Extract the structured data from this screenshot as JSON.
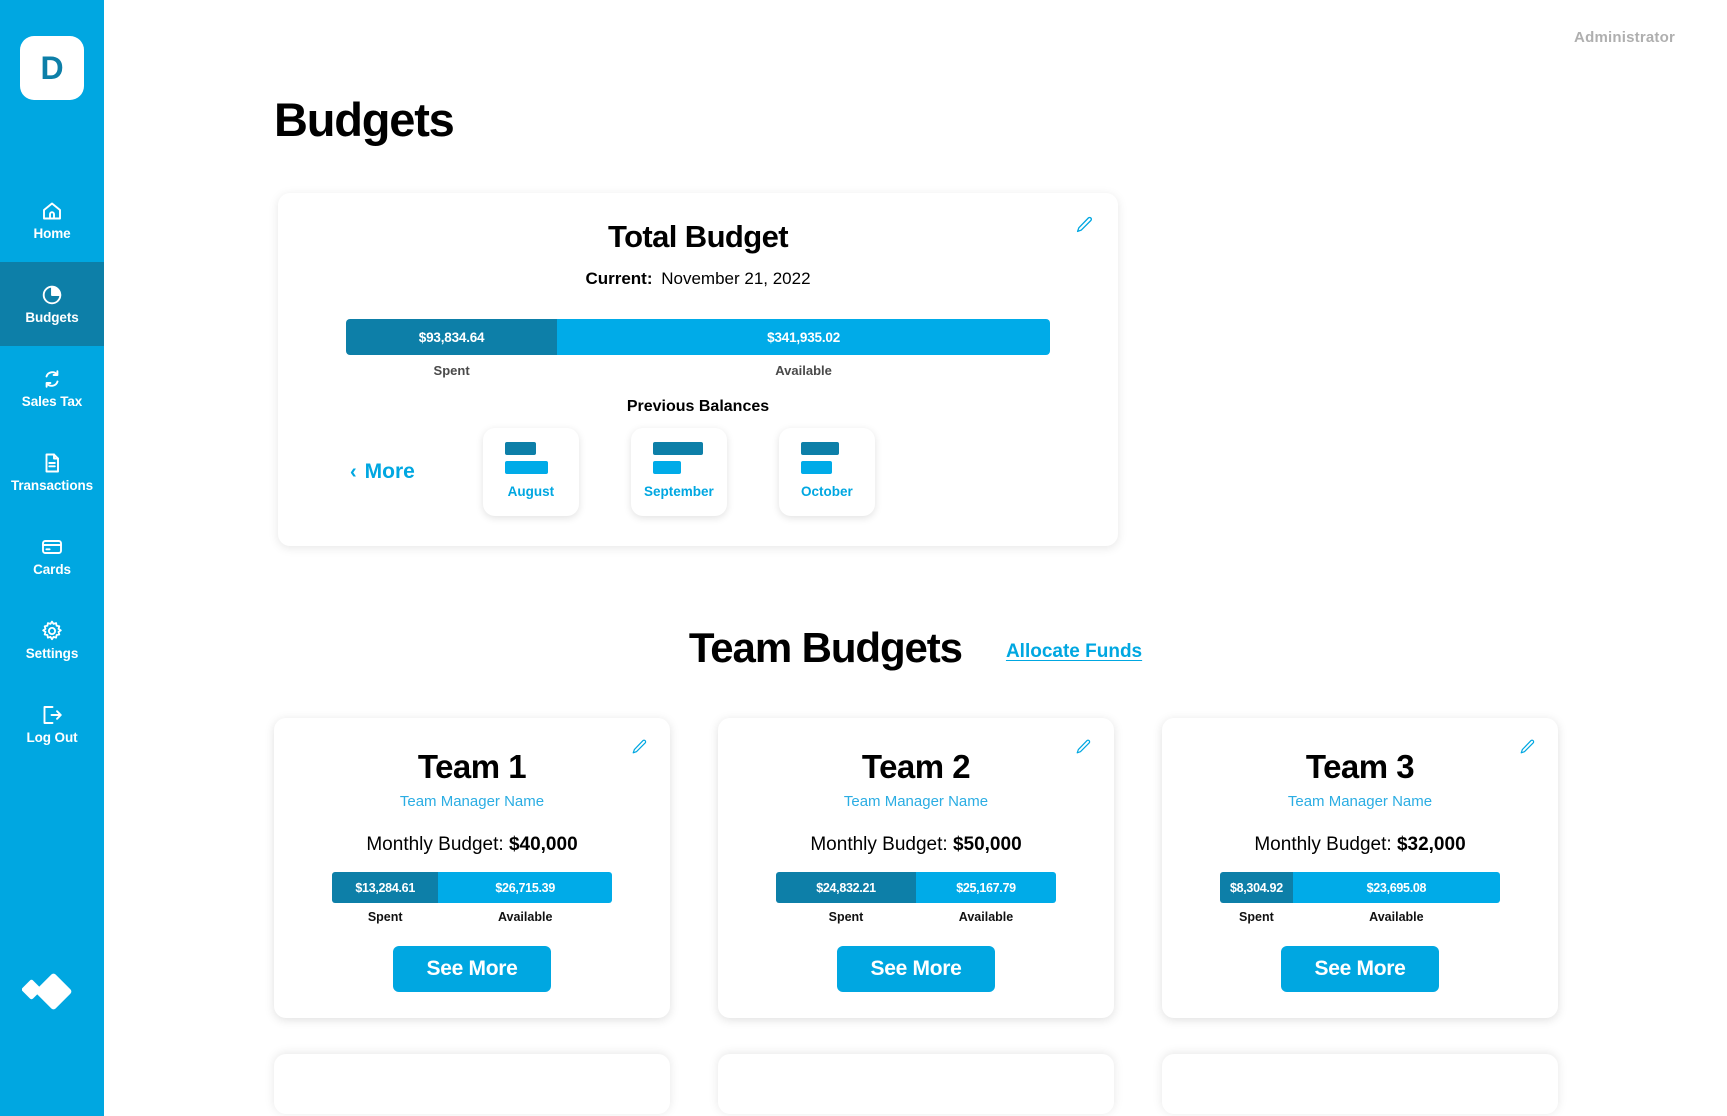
{
  "sidebar": {
    "brand_initial": "D",
    "items": [
      {
        "label": "Home",
        "icon": "home-icon",
        "active": false
      },
      {
        "label": "Budgets",
        "icon": "pie-chart-icon",
        "active": true
      },
      {
        "label": "Sales Tax",
        "icon": "refresh-icon",
        "active": false
      },
      {
        "label": "Transactions",
        "icon": "document-icon",
        "active": false
      },
      {
        "label": "Cards",
        "icon": "credit-card-icon",
        "active": false
      },
      {
        "label": "Settings",
        "icon": "gear-icon",
        "active": false
      },
      {
        "label": "Log Out",
        "icon": "logout-icon",
        "active": false
      }
    ],
    "brand_mark": "diamond-logo-icon",
    "bg_color": "#00A7E1",
    "active_bg_color": "#0D7FA8"
  },
  "topbar": {
    "role": "Administrator"
  },
  "page": {
    "title": "Budgets"
  },
  "total_budget": {
    "title": "Total Budget",
    "current_label": "Current:",
    "current_value": "November 21, 2022",
    "spent_amount": "$93,834.64",
    "available_amount": "$341,935.02",
    "spent_label": "Spent",
    "available_label": "Available",
    "spent_pct": 30,
    "available_pct": 70,
    "previous_balances_label": "Previous Balances",
    "more_label": "More",
    "more_chevron": "chevron-left-icon",
    "edit_icon": "pencil-icon",
    "months": [
      {
        "label": "August",
        "dark_width": 42,
        "light_width": 58
      },
      {
        "label": "September",
        "dark_width": 68,
        "light_width": 38
      },
      {
        "label": "October",
        "dark_width": 52,
        "light_width": 42
      }
    ]
  },
  "team_budgets": {
    "heading": "Team Budgets",
    "allocate_label": "Allocate Funds",
    "monthly_budget_prefix": "Monthly Budget:",
    "spent_label": "Spent",
    "available_label": "Available",
    "see_more_label": "See More",
    "manager_label": "Team Manager Name",
    "edit_icon": "pencil-icon",
    "cards": [
      {
        "name": "Team 1",
        "manager": "Team Manager Name",
        "monthly_budget": "$40,000",
        "spent": "$13,284.61",
        "available": "$26,715.39",
        "spent_pct": 38,
        "available_pct": 62
      },
      {
        "name": "Team 2",
        "manager": "Team Manager Name",
        "monthly_budget": "$50,000",
        "spent": "$24,832.21",
        "available": "$25,167.79",
        "spent_pct": 50,
        "available_pct": 50
      },
      {
        "name": "Team 3",
        "manager": "Team Manager Name",
        "monthly_budget": "$32,000",
        "spent": "$8,304.92",
        "available": "$23,695.08",
        "spent_pct": 26,
        "available_pct": 74
      }
    ]
  },
  "colors": {
    "brand": "#00A7E1",
    "brand_dark": "#0D7FA8",
    "bar_spent": "#0D7FA8",
    "bar_available": "#00ABE8",
    "link": "#00A7E1",
    "muted_text": "#AFAFAF"
  }
}
